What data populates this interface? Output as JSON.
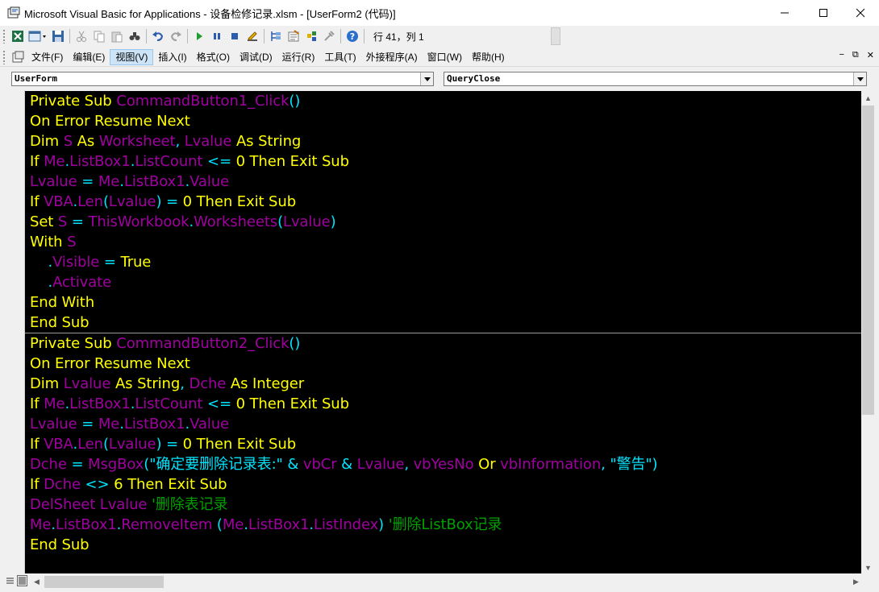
{
  "window": {
    "title": "Microsoft Visual Basic for Applications - 设备检修记录.xlsm - [UserForm2 (代码)]",
    "minimize_glyph": "—",
    "maximize_glyph": "☐",
    "close_glyph": "✕"
  },
  "toolbar": {
    "position_text": "行 41，列 1"
  },
  "menu": {
    "items": [
      "文件(F)",
      "编辑(E)",
      "视图(V)",
      "插入(I)",
      "格式(O)",
      "调试(D)",
      "运行(R)",
      "工具(T)",
      "外接程序(A)",
      "窗口(W)",
      "帮助(H)"
    ],
    "active_index": 2,
    "mdi_controls": [
      "−",
      "⧉",
      "✕"
    ]
  },
  "object_combo": {
    "value": "UserForm"
  },
  "procedure_combo": {
    "value": "QueryClose"
  },
  "code": {
    "procedures": [
      {
        "lines": [
          [
            [
              "k",
              "Private Sub "
            ],
            [
              "id",
              "CommandButton1_Click"
            ],
            [
              "op",
              "()"
            ]
          ],
          [
            [
              "k",
              "On Error Resume Next"
            ]
          ],
          [
            [
              "k",
              "Dim "
            ],
            [
              "id",
              "S"
            ],
            [
              "k",
              " As "
            ],
            [
              "id",
              "Worksheet"
            ],
            [
              "op",
              ", "
            ],
            [
              "id",
              "Lvalue"
            ],
            [
              "k",
              " As String"
            ]
          ],
          [
            [
              "k",
              "If "
            ],
            [
              "id",
              "Me"
            ],
            [
              "op",
              "."
            ],
            [
              "id",
              "ListBox1"
            ],
            [
              "op",
              "."
            ],
            [
              "id",
              "ListCount"
            ],
            [
              "op",
              " <= "
            ],
            [
              "k",
              "0 Then Exit Sub"
            ]
          ],
          [
            [
              "id",
              "Lvalue"
            ],
            [
              "op",
              " = "
            ],
            [
              "id",
              "Me"
            ],
            [
              "op",
              "."
            ],
            [
              "id",
              "ListBox1"
            ],
            [
              "op",
              "."
            ],
            [
              "id",
              "Value"
            ]
          ],
          [
            [
              "k",
              "If "
            ],
            [
              "id",
              "VBA"
            ],
            [
              "op",
              "."
            ],
            [
              "id",
              "Len"
            ],
            [
              "op",
              "("
            ],
            [
              "id",
              "Lvalue"
            ],
            [
              "op",
              ") = "
            ],
            [
              "k",
              "0 Then Exit Sub"
            ]
          ],
          [
            [
              "k",
              "Set "
            ],
            [
              "id",
              "S"
            ],
            [
              "op",
              " = "
            ],
            [
              "id",
              "ThisWorkbook"
            ],
            [
              "op",
              "."
            ],
            [
              "id",
              "Worksheets"
            ],
            [
              "op",
              "("
            ],
            [
              "id",
              "Lvalue"
            ],
            [
              "op",
              ")"
            ]
          ],
          [
            [
              "k",
              "With "
            ],
            [
              "id",
              "S"
            ]
          ],
          [
            [
              "op",
              "    ."
            ],
            [
              "id",
              "Visible"
            ],
            [
              "op",
              " = "
            ],
            [
              "k",
              "True"
            ]
          ],
          [
            [
              "op",
              "    ."
            ],
            [
              "id",
              "Activate"
            ]
          ],
          [
            [
              "k",
              "End With"
            ]
          ],
          [
            [
              "k",
              "End Sub"
            ]
          ]
        ]
      },
      {
        "lines": [
          [
            [
              "k",
              "Private Sub "
            ],
            [
              "id",
              "CommandButton2_Click"
            ],
            [
              "op",
              "()"
            ]
          ],
          [
            [
              "k",
              "On Error Resume Next"
            ]
          ],
          [
            [
              "k",
              "Dim "
            ],
            [
              "id",
              "Lvalue"
            ],
            [
              "k",
              " As String"
            ],
            [
              "op",
              ", "
            ],
            [
              "id",
              "Dche"
            ],
            [
              "k",
              " As Integer"
            ]
          ],
          [
            [
              "k",
              "If "
            ],
            [
              "id",
              "Me"
            ],
            [
              "op",
              "."
            ],
            [
              "id",
              "ListBox1"
            ],
            [
              "op",
              "."
            ],
            [
              "id",
              "ListCount"
            ],
            [
              "op",
              " <= "
            ],
            [
              "k",
              "0 Then Exit Sub"
            ]
          ],
          [
            [
              "id",
              "Lvalue"
            ],
            [
              "op",
              " = "
            ],
            [
              "id",
              "Me"
            ],
            [
              "op",
              "."
            ],
            [
              "id",
              "ListBox1"
            ],
            [
              "op",
              "."
            ],
            [
              "id",
              "Value"
            ]
          ],
          [
            [
              "k",
              "If "
            ],
            [
              "id",
              "VBA"
            ],
            [
              "op",
              "."
            ],
            [
              "id",
              "Len"
            ],
            [
              "op",
              "("
            ],
            [
              "id",
              "Lvalue"
            ],
            [
              "op",
              ") = "
            ],
            [
              "k",
              "0 Then Exit Sub"
            ]
          ],
          [
            [
              "id",
              "Dche"
            ],
            [
              "op",
              " = "
            ],
            [
              "id",
              "MsgBox"
            ],
            [
              "op",
              "(\"确定要删除记录表:\" & "
            ],
            [
              "id",
              "vbCr"
            ],
            [
              "op",
              " & "
            ],
            [
              "id",
              "Lvalue"
            ],
            [
              "op",
              ", "
            ],
            [
              "id",
              "vbYesNo"
            ],
            [
              "k",
              " Or "
            ],
            [
              "id",
              "vbInformation"
            ],
            [
              "op",
              ", \"警告\")"
            ]
          ],
          [
            [
              "k",
              "If "
            ],
            [
              "id",
              "Dche"
            ],
            [
              "op",
              " <> "
            ],
            [
              "k",
              "6 Then Exit Sub"
            ]
          ],
          [
            [
              "id",
              "DelSheet Lvalue"
            ],
            [
              "cm",
              " '删除表记录"
            ]
          ],
          [
            [
              "id",
              "Me"
            ],
            [
              "op",
              "."
            ],
            [
              "id",
              "ListBox1"
            ],
            [
              "op",
              "."
            ],
            [
              "id",
              "RemoveItem"
            ],
            [
              "op",
              " ("
            ],
            [
              "id",
              "Me"
            ],
            [
              "op",
              "."
            ],
            [
              "id",
              "ListBox1"
            ],
            [
              "op",
              "."
            ],
            [
              "id",
              "ListIndex"
            ],
            [
              "op",
              ")"
            ],
            [
              "cm",
              " '删除ListBox记录"
            ]
          ],
          [
            [
              "k",
              "End Sub"
            ]
          ]
        ]
      }
    ]
  },
  "colors": {
    "keyword": "#ffff00",
    "identifier": "#a000a0",
    "operator": "#00e5ff",
    "comment": "#00a000",
    "code_background": "#000000"
  }
}
